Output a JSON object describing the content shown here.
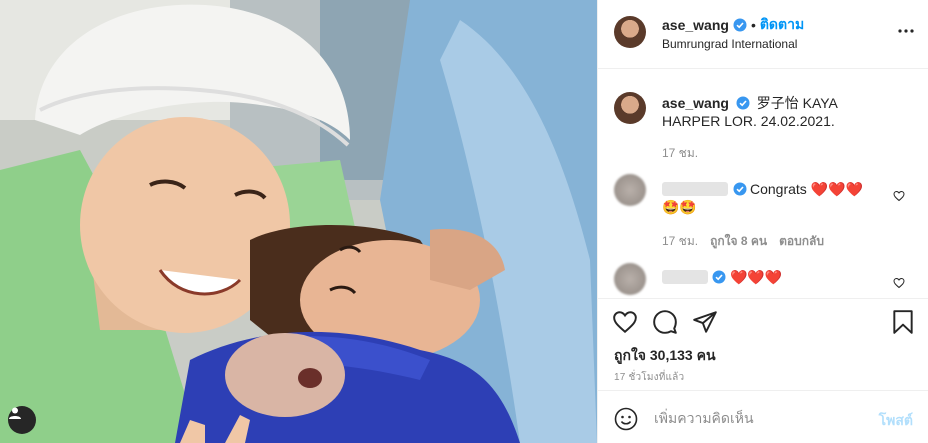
{
  "header": {
    "username": "ase_wang",
    "separator": "•",
    "follow_label": "ติดตาม",
    "location": "Bumrungrad International",
    "more_icon": "more-horizontal-icon"
  },
  "caption": {
    "username": "ase_wang",
    "text": "罗子怡 KAYA HARPER LOR. 24.02.2021.",
    "time": "17 ชม."
  },
  "comments": [
    {
      "text": "Congrats ❤️❤️❤️ 🤩🤩",
      "time": "17 ชม.",
      "likes": "ถูกใจ 8 คน",
      "reply": "ตอบกลับ"
    },
    {
      "text": "❤️❤️❤️"
    }
  ],
  "actions": {
    "like_icon": "heart-icon",
    "comment_icon": "comment-icon",
    "share_icon": "share-icon",
    "save_icon": "bookmark-icon",
    "likes_text": "ถูกใจ 30,133 คน",
    "time_ago": "17 ชั่วโมงที่แล้ว"
  },
  "add_comment": {
    "placeholder": "เพิ่มความคิดเห็น",
    "post_label": "โพสต์"
  },
  "colors": {
    "accent": "#0095f6",
    "verified": "#3897f0",
    "post_disabled": "#b2dffc",
    "heart": "#ed1c24"
  }
}
